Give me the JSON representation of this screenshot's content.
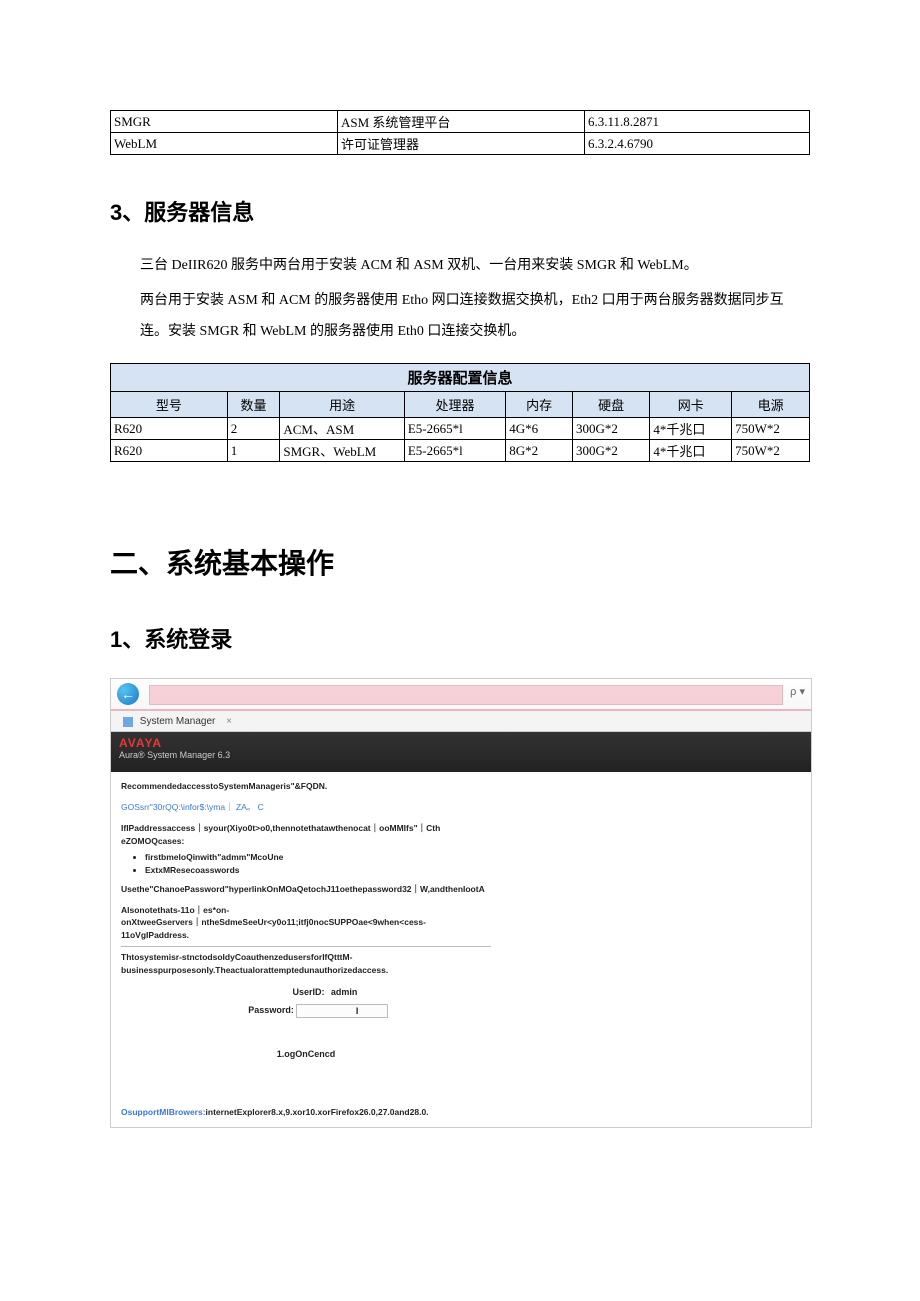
{
  "top_table": {
    "rows": [
      {
        "c1": "SMGR",
        "c2": "ASM 系统管理平台",
        "c3": "6.3.11.8.2871"
      },
      {
        "c1": "WebLM",
        "c2": "许可证管理器",
        "c3": "6.3.2.4.6790"
      }
    ]
  },
  "section3": {
    "heading": "3、服务器信息",
    "p1": "三台 DeIIR620 服务中两台用于安装 ACM 和 ASM 双机、一台用来安装 SMGR 和 WebLM。",
    "p2": "两台用于安装 ASM 和 ACM 的服务器使用 Etho 网口连接数据交换机，Eth2 口用于两台服务器数据同步互连。安装 SMGR 和 WebLM 的服务器使用 Eth0 口连接交换机。"
  },
  "server_table": {
    "title": "服务器配置信息",
    "headers": [
      "型号",
      "数量",
      "用途",
      "处理器",
      "内存",
      "硬盘",
      "网卡",
      "电源"
    ],
    "rows": [
      [
        "R620",
        "2",
        "ACM、ASM",
        "E5-2665*l",
        "4G*6",
        "300G*2",
        "4*千兆口",
        "750W*2"
      ],
      [
        "R620",
        "1",
        "SMGR、WebLM",
        "E5-2665*l",
        "8G*2",
        "300G*2",
        "4*千兆口",
        "750W*2"
      ]
    ]
  },
  "chapter2": "二、系统基本操作",
  "section_login": "1、系统登录",
  "login": {
    "tab_label": "System Manager",
    "logo": "AVAYA",
    "logo_sub": "Aura® System Manager 6.3",
    "rec": "RecommendedaccesstoSystemManageris\"&FQDN.",
    "gos": "GOSsrr\"30rQQ:\\infor$:\\yma｜ ZA。  C",
    "p1": "IfIPaddressaccess｜syour(Xiyo0t>o0,thennotethatawthenocat｜ooMMIfs\"｜Cth",
    "p1b": "eZOMOQcases:",
    "li1": "firstbmeloQinwith\"admm\"McoUne",
    "li2": "ExtxMResecoasswords",
    "p2": "Usethe\"ChanoePassword\"hyperlinkOnMOaQetochJ11oethepassword32｜W,andthenIootA",
    "p3a": "Alsonotethats-11o｜es*on-",
    "p3b": "onXtweeGservers｜ntheSdmeSeeUr<y0o11;itfj0nocSUPPOae<9when<cess-11oVgIPaddress.",
    "p4": "Thtosystemisr-stnctodsoIdyCoauthenzedusersforIfQtttM-businesspurposesonIy.Theactualorattemptedunauthorizedaccess.",
    "userid_label": "UserID:",
    "userid_value": "admin",
    "password_label": "Password:",
    "password_value": "I",
    "login_btn": "1.ogOnCencd",
    "footer_blue": "OsupportMIBrowers:",
    "footer_black": "internetExplorer8.x,9.xor10.xorFirefox26.0,27.0and28.0."
  }
}
